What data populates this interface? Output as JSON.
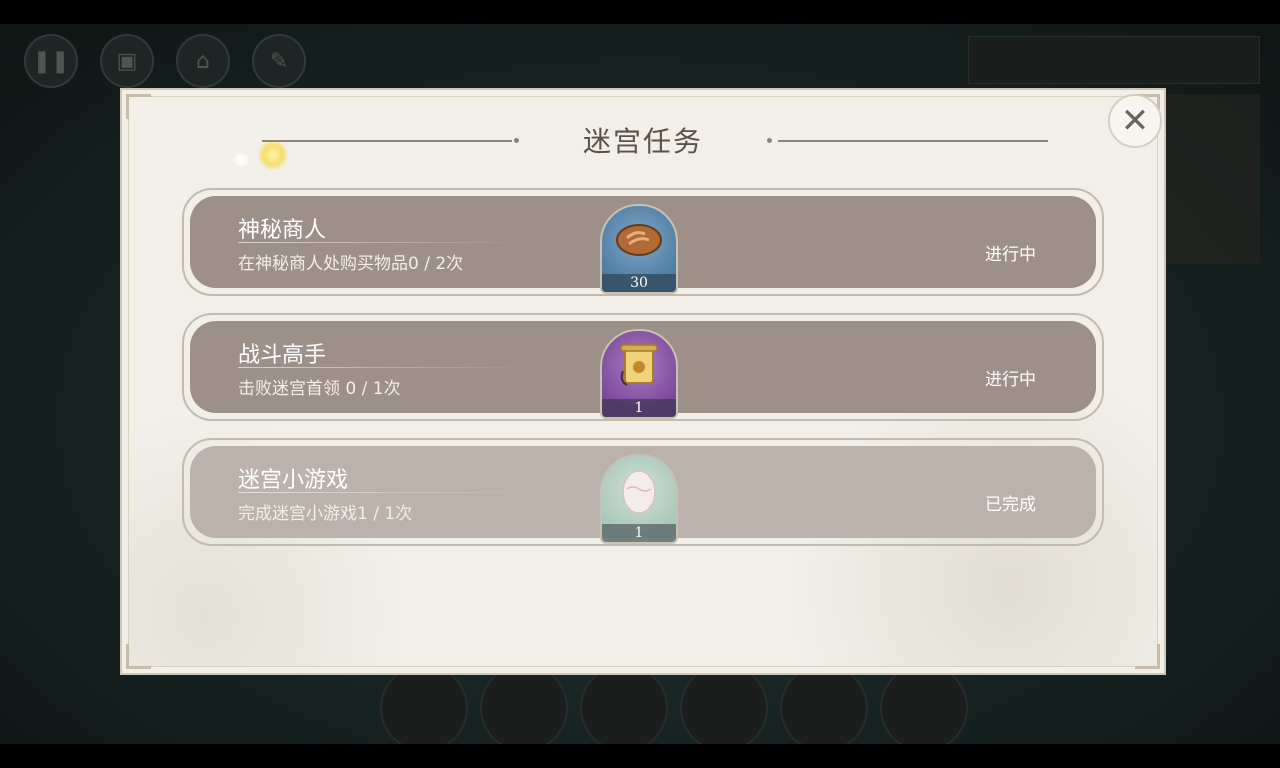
{
  "modal": {
    "title": "迷宫任务",
    "close_symbol": "✕"
  },
  "tasks": [
    {
      "name": "神秘商人",
      "description": "在神秘商人处购买物品0 / 2次",
      "reward_icon": "bread-icon",
      "reward_qty": "30",
      "status": "进行中"
    },
    {
      "name": "战斗高手",
      "description": "击败迷宫首领 0 / 1次",
      "reward_icon": "scroll-icon",
      "reward_qty": "1",
      "status": "进行中"
    },
    {
      "name": "迷宫小游戏",
      "description": "完成迷宫小游戏1 / 1次",
      "reward_icon": "egg-icon",
      "reward_qty": "1",
      "status": "已完成"
    }
  ],
  "colors": {
    "panel_bg": "#f1efe8",
    "row_active": "#9c9088",
    "row_done": "#bbb3ab",
    "title_text": "#5c5147"
  }
}
